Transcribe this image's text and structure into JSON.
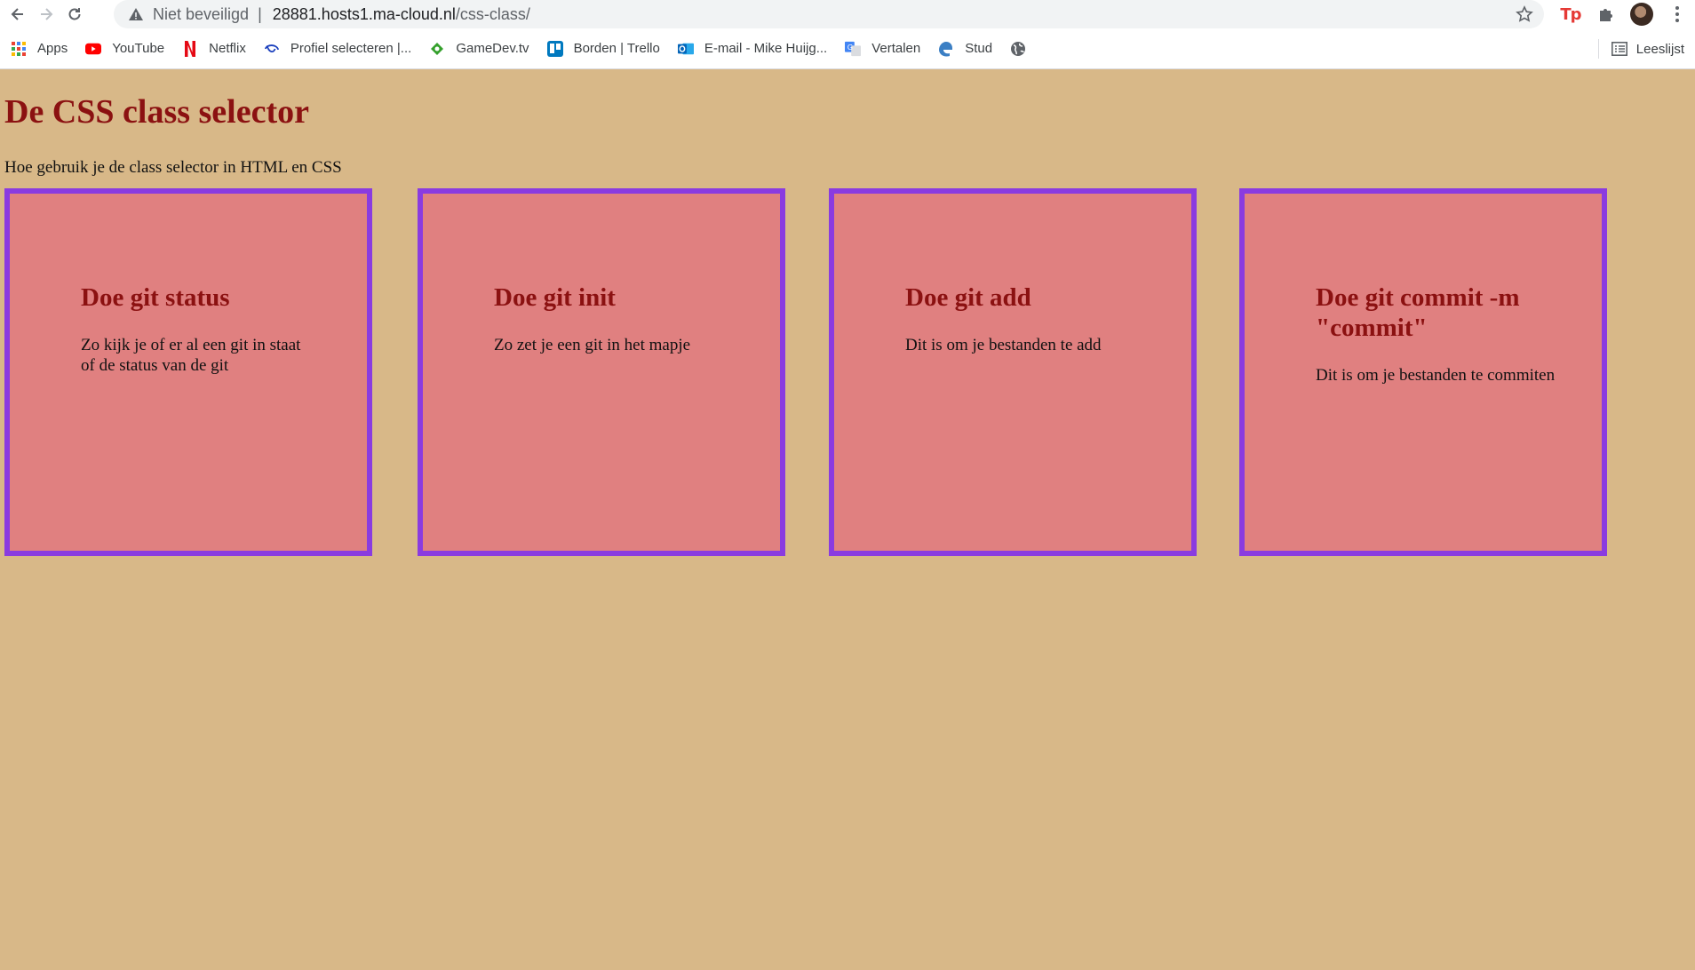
{
  "browser": {
    "security_label": "Niet beveiligd",
    "url_host": "28881.hosts1.ma-cloud.nl",
    "url_path": "/css-class/",
    "bookmarks": [
      {
        "label": "Apps",
        "icon": "apps-grid-icon"
      },
      {
        "label": "YouTube",
        "icon": "youtube-icon"
      },
      {
        "label": "Netflix",
        "icon": "netflix-icon"
      },
      {
        "label": "Profiel selecteren |...",
        "icon": "disney-icon"
      },
      {
        "label": "GameDev.tv",
        "icon": "gamedev-icon"
      },
      {
        "label": "Borden | Trello",
        "icon": "trello-icon"
      },
      {
        "label": "E-mail - Mike Huijg...",
        "icon": "outlook-icon"
      },
      {
        "label": "Vertalen",
        "icon": "translate-icon"
      },
      {
        "label": "Stud",
        "icon": "edge-icon"
      }
    ],
    "reading_list_label": "Leeslijst",
    "colors": {
      "page_bg": "#d8b888",
      "heading": "#8b1111",
      "card_bg": "#e08080",
      "card_border": "#8a3be0"
    }
  },
  "page": {
    "title": "De CSS class selector",
    "intro": "Hoe gebruik je de class selector in HTML en CSS",
    "cards": [
      {
        "title": "Doe git status",
        "text": "Zo kijk je of er al een git in staat of de status van de git"
      },
      {
        "title": "Doe git init",
        "text": "Zo zet je een git in het mapje"
      },
      {
        "title": "Doe git add",
        "text": "Dit is om je bestanden te add"
      },
      {
        "title": "Doe git commit -m \"commit\"",
        "text": "Dit is om je bestanden te commiten"
      }
    ]
  }
}
